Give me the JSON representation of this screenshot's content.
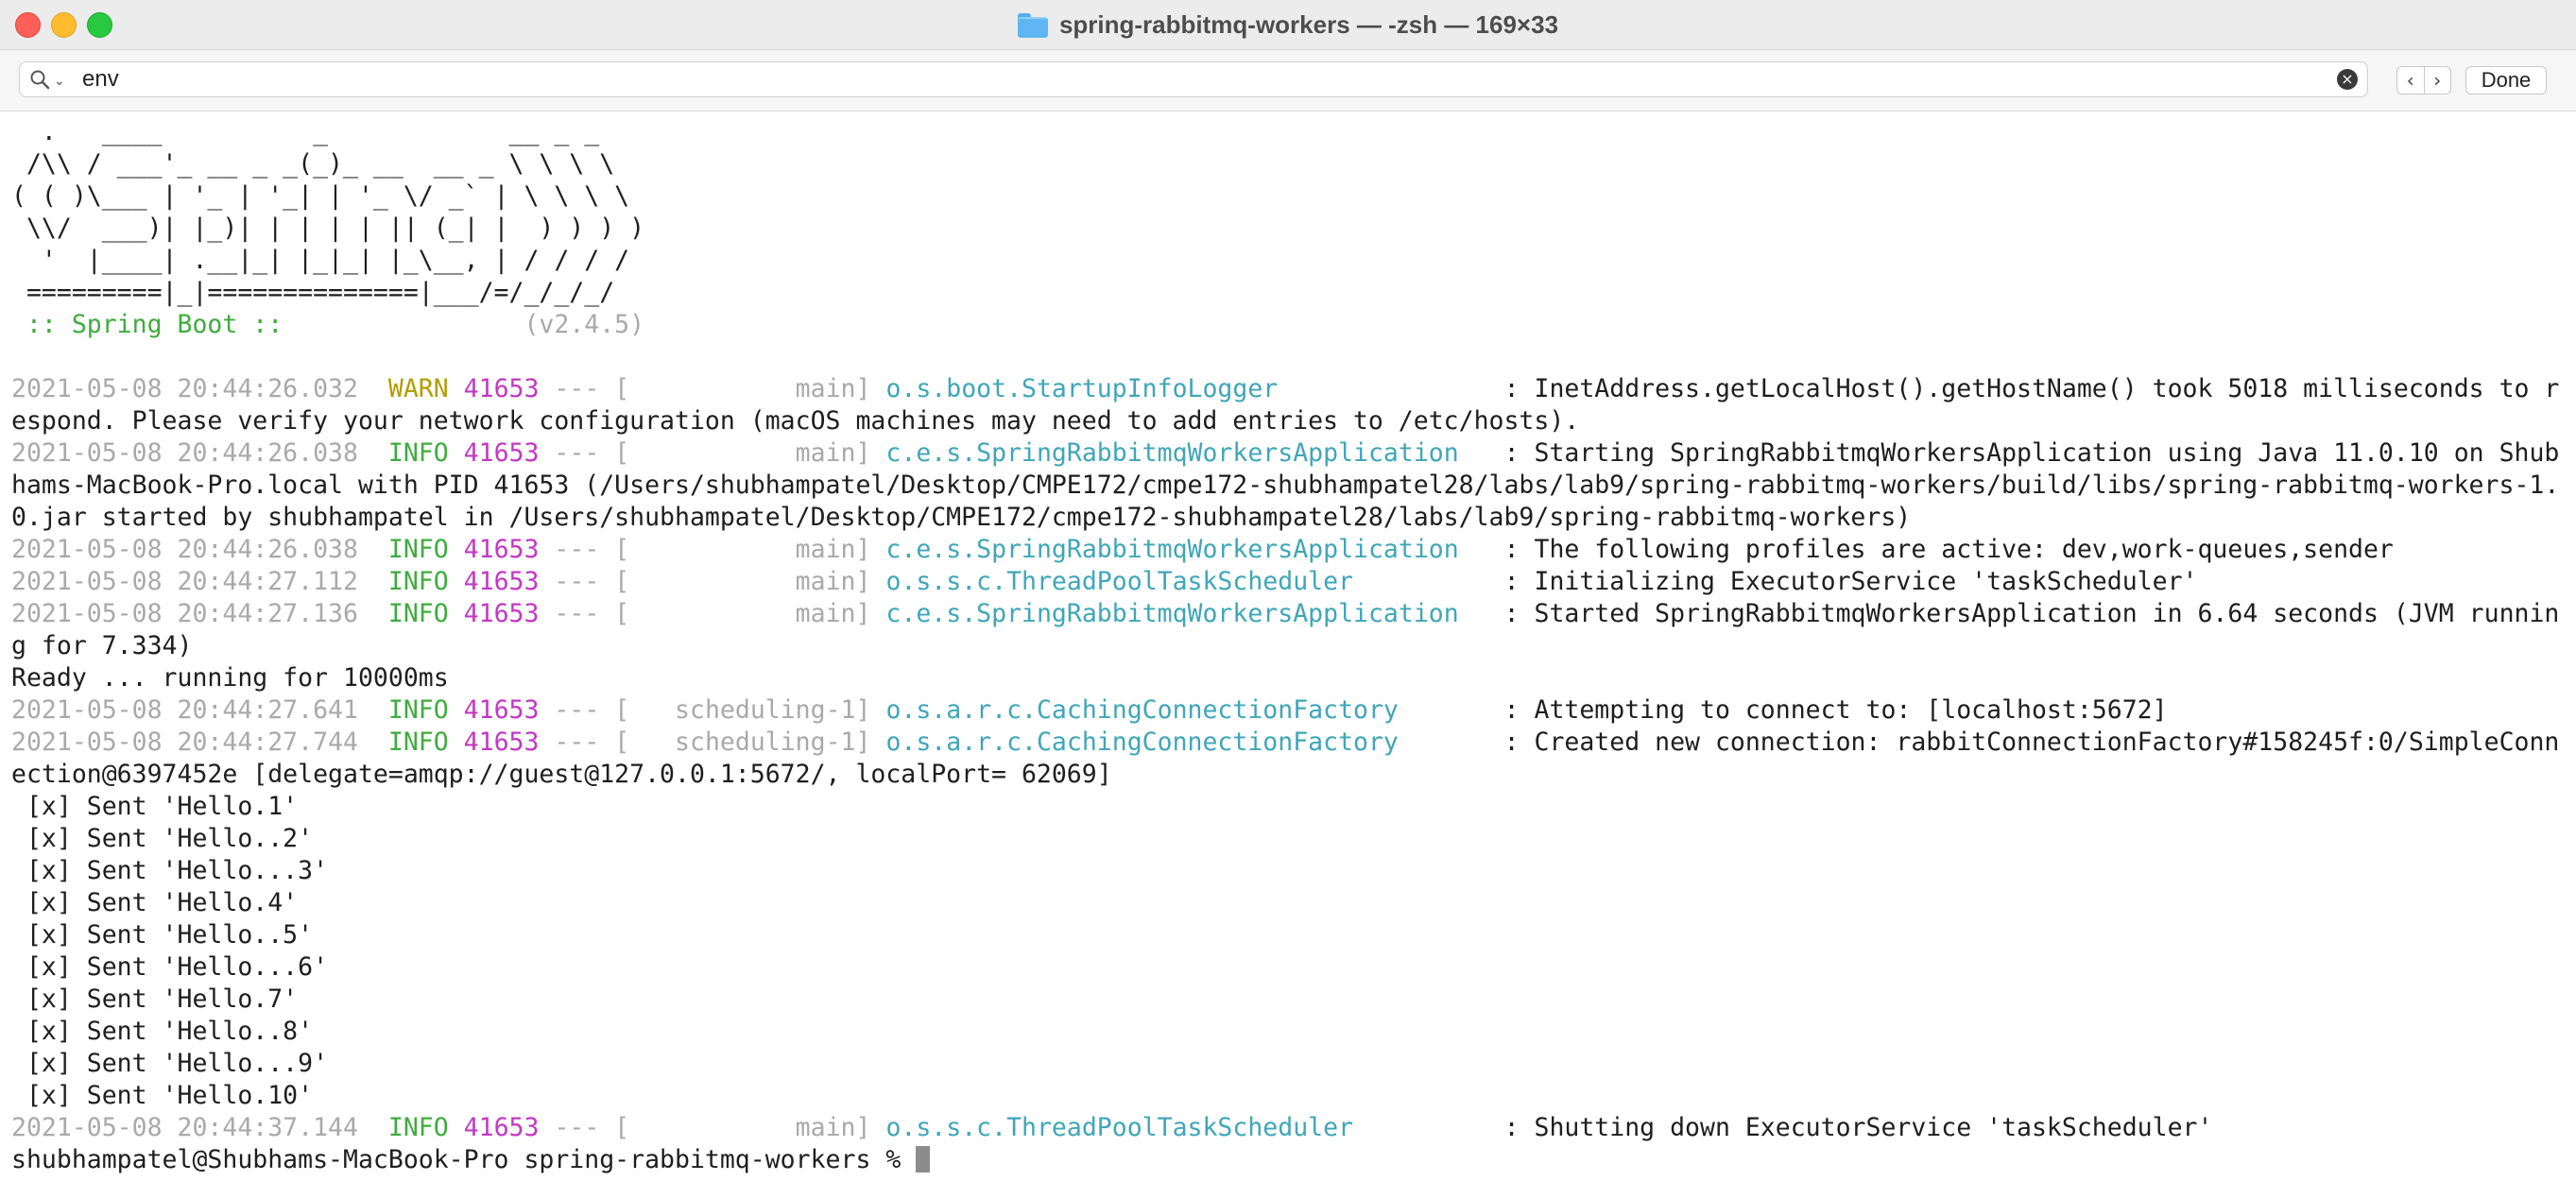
{
  "window": {
    "title": "spring-rabbitmq-workers — -zsh — 169×33"
  },
  "find": {
    "query": "env",
    "prev_label": "‹",
    "next_label": "›",
    "done_label": "Done"
  },
  "banner": {
    "lines": [
      "  .   ____          _            __ _ _",
      " /\\\\ / ___'_ __ _ _(_)_ __  __ _ \\ \\ \\ \\",
      "( ( )\\___ | '_ | '_| | '_ \\/ _` | \\ \\ \\ \\",
      " \\\\/  ___)| |_)| | | | | || (_| |  ) ) ) )",
      "  '  |____| .__|_| |_|_| |_\\__, | / / / /",
      " =========|_|==============|___/=/_/_/_/"
    ],
    "spring_label": " :: Spring Boot :: ",
    "version": "               (v2.4.5)"
  },
  "log": {
    "entries": [
      {
        "ts": "2021-05-08 20:44:26.032",
        "level": "WARN",
        "pid": "41653",
        "sep": " --- [",
        "thread": "           main]",
        "logger": "o.s.boot.StartupInfoLogger              ",
        "msg": " : InetAddress.getLocalHost().getHostName() took 5018 milliseconds to r",
        "cont": [
          "espond. Please verify your network configuration (macOS machines may need to add entries to /etc/hosts)."
        ]
      },
      {
        "ts": "2021-05-08 20:44:26.038",
        "level": "INFO",
        "pid": "41653",
        "sep": " --- [",
        "thread": "           main]",
        "logger": "c.e.s.SpringRabbitmqWorkersApplication  ",
        "msg": " : Starting SpringRabbitmqWorkersApplication using Java 11.0.10 on Shub",
        "cont": [
          "hams-MacBook-Pro.local with PID 41653 (/Users/shubhampatel/Desktop/CMPE172/cmpe172-shubhampatel28/labs/lab9/spring-rabbitmq-workers/build/libs/spring-rabbitmq-workers-1.",
          "0.jar started by shubhampatel in /Users/shubhampatel/Desktop/CMPE172/cmpe172-shubhampatel28/labs/lab9/spring-rabbitmq-workers)"
        ]
      },
      {
        "ts": "2021-05-08 20:44:26.038",
        "level": "INFO",
        "pid": "41653",
        "sep": " --- [",
        "thread": "           main]",
        "logger": "c.e.s.SpringRabbitmqWorkersApplication  ",
        "msg": " : The following profiles are active: dev,work-queues,sender",
        "cont": []
      },
      {
        "ts": "2021-05-08 20:44:27.112",
        "level": "INFO",
        "pid": "41653",
        "sep": " --- [",
        "thread": "           main]",
        "logger": "o.s.s.c.ThreadPoolTaskScheduler         ",
        "msg": " : Initializing ExecutorService 'taskScheduler'",
        "cont": []
      },
      {
        "ts": "2021-05-08 20:44:27.136",
        "level": "INFO",
        "pid": "41653",
        "sep": " --- [",
        "thread": "           main]",
        "logger": "c.e.s.SpringRabbitmqWorkersApplication  ",
        "msg": " : Started SpringRabbitmqWorkersApplication in 6.64 seconds (JVM runnin",
        "cont": [
          "g for 7.334)"
        ]
      }
    ],
    "ready_line": "Ready ... running for 10000ms",
    "entries2": [
      {
        "ts": "2021-05-08 20:44:27.641",
        "level": "INFO",
        "pid": "41653",
        "sep": " --- [",
        "thread": "   scheduling-1]",
        "logger": "o.s.a.r.c.CachingConnectionFactory      ",
        "msg": " : Attempting to connect to: [localhost:5672]",
        "cont": []
      },
      {
        "ts": "2021-05-08 20:44:27.744",
        "level": "INFO",
        "pid": "41653",
        "sep": " --- [",
        "thread": "   scheduling-1]",
        "logger": "o.s.a.r.c.CachingConnectionFactory      ",
        "msg": " : Created new connection: rabbitConnectionFactory#158245f:0/SimpleConn",
        "cont": [
          "ection@6397452e [delegate=amqp://guest@127.0.0.1:5672/, localPort= 62069]"
        ]
      }
    ],
    "sent": [
      " [x] Sent 'Hello.1'",
      " [x] Sent 'Hello..2'",
      " [x] Sent 'Hello...3'",
      " [x] Sent 'Hello.4'",
      " [x] Sent 'Hello..5'",
      " [x] Sent 'Hello...6'",
      " [x] Sent 'Hello.7'",
      " [x] Sent 'Hello..8'",
      " [x] Sent 'Hello...9'",
      " [x] Sent 'Hello.10'"
    ],
    "final_entry": {
      "ts": "2021-05-08 20:44:37.144",
      "level": "INFO",
      "pid": "41653",
      "sep": " --- [",
      "thread": "           main]",
      "logger": "o.s.s.c.ThreadPoolTaskScheduler         ",
      "msg": " : Shutting down ExecutorService 'taskScheduler'"
    },
    "prompt": "shubhampatel@Shubhams-MacBook-Pro spring-rabbitmq-workers % "
  }
}
